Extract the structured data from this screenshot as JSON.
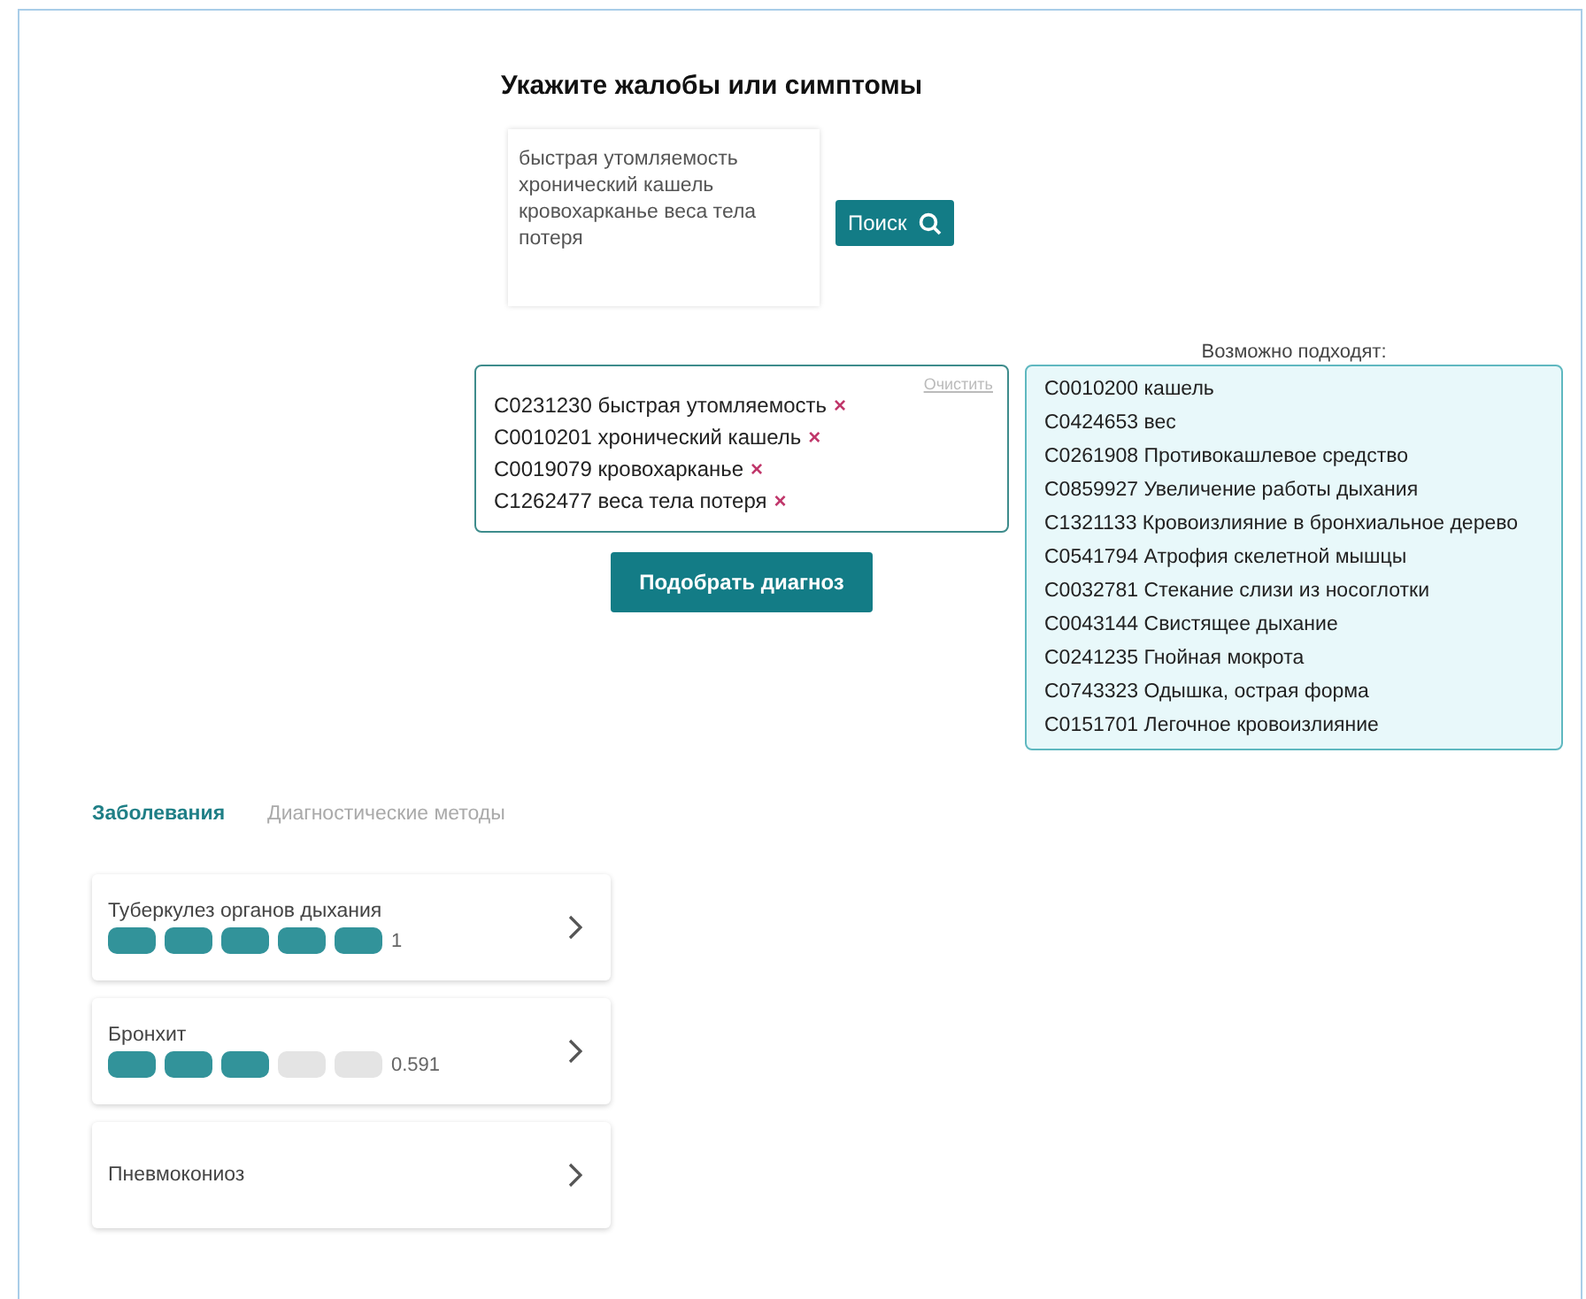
{
  "heading": "Укажите жалобы или симптомы",
  "search": {
    "value": "быстрая утомляемость хронический кашель кровохарканье веса тела потеря",
    "button": "Поиск"
  },
  "selected": {
    "clear_link": "Очистить",
    "items": [
      {
        "text": "C0231230 быстрая утомляемость",
        "remove": "×"
      },
      {
        "text": "C0010201 хронический кашель",
        "remove": "×"
      },
      {
        "text": "C0019079 кровохарканье",
        "remove": "×"
      },
      {
        "text": "C1262477 веса тела потеря",
        "remove": "×"
      }
    ]
  },
  "diagnose_button": "Подобрать диагноз",
  "suggestions": {
    "label": "Возможно подходят:",
    "items": [
      "C0010200 кашель",
      "C0424653 вес",
      "C0261908 Противокашлевое средство",
      "C0859927 Увеличение работы дыхания",
      "C1321133 Кровоизлияние в бронхиальное дерево",
      "C0541794 Атрофия скелетной мышцы",
      "C0032781 Стекание слизи из носоглотки",
      "C0043144 Свистящее дыхание",
      "C0241235 Гнойная мокрота",
      "C0743323 Одышка, острая форма",
      "C0151701 Легочное кровоизлияние"
    ]
  },
  "tabs": [
    {
      "label": "Заболевания",
      "selected": true
    },
    {
      "label": "Диагностические методы",
      "selected": false
    }
  ],
  "diseases": [
    {
      "name": "Туберкулез органов дыхания",
      "stars": 5,
      "score": "1"
    },
    {
      "name": "Бронхит",
      "stars": 3,
      "score": "0.591"
    },
    {
      "name": "Пневмокониоз"
    }
  ]
}
